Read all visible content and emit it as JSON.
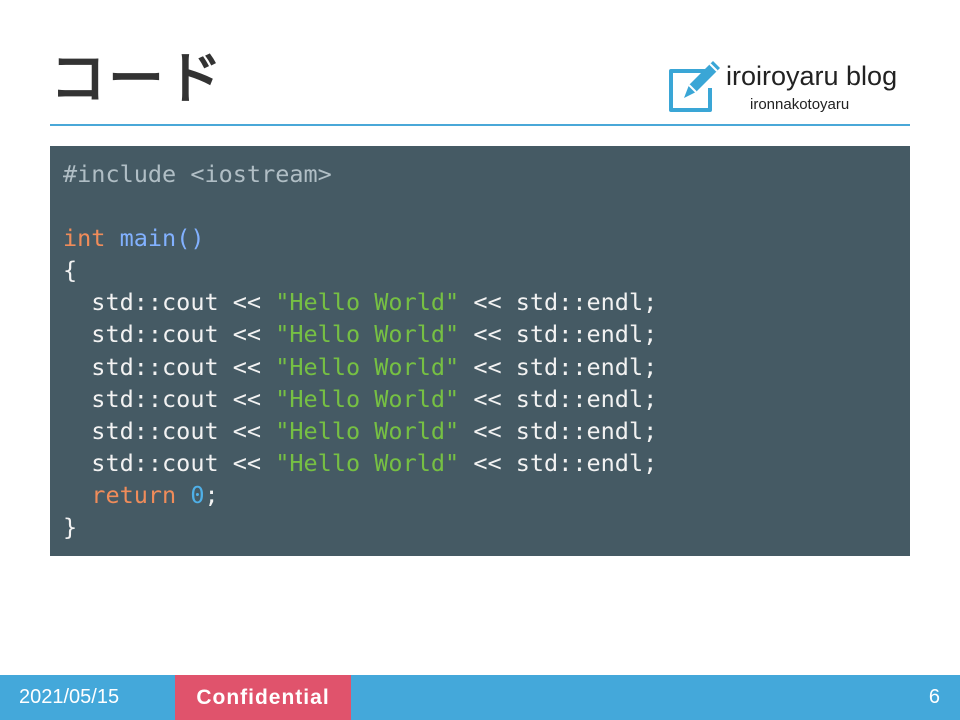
{
  "slide": {
    "title": "コード"
  },
  "logo": {
    "icon": "edit-document-icon",
    "name": "iroiroyaru blog",
    "subtitle": "ironnakotoyaru",
    "color": "#3aa6d6"
  },
  "code": {
    "background": "#455a64",
    "lines": [
      [
        {
          "t": "#include <iostream>",
          "c": "pre"
        }
      ],
      [],
      [
        {
          "t": "int",
          "c": "kw"
        },
        {
          "t": " ",
          "c": "txt"
        },
        {
          "t": "main()",
          "c": "fn"
        }
      ],
      [
        {
          "t": "{",
          "c": "txt"
        }
      ],
      [
        {
          "t": "  std::cout << ",
          "c": "txt"
        },
        {
          "t": "\"Hello World\"",
          "c": "str"
        },
        {
          "t": " << std::endl;",
          "c": "txt"
        }
      ],
      [
        {
          "t": "  std::cout << ",
          "c": "txt"
        },
        {
          "t": "\"Hello World\"",
          "c": "str"
        },
        {
          "t": " << std::endl;",
          "c": "txt"
        }
      ],
      [
        {
          "t": "  std::cout << ",
          "c": "txt"
        },
        {
          "t": "\"Hello World\"",
          "c": "str"
        },
        {
          "t": " << std::endl;",
          "c": "txt"
        }
      ],
      [
        {
          "t": "  std::cout << ",
          "c": "txt"
        },
        {
          "t": "\"Hello World\"",
          "c": "str"
        },
        {
          "t": " << std::endl;",
          "c": "txt"
        }
      ],
      [
        {
          "t": "  std::cout << ",
          "c": "txt"
        },
        {
          "t": "\"Hello World\"",
          "c": "str"
        },
        {
          "t": " << std::endl;",
          "c": "txt"
        }
      ],
      [
        {
          "t": "  std::cout << ",
          "c": "txt"
        },
        {
          "t": "\"Hello World\"",
          "c": "str"
        },
        {
          "t": " << std::endl;",
          "c": "txt"
        }
      ],
      [
        {
          "t": "  ",
          "c": "txt"
        },
        {
          "t": "return",
          "c": "kw"
        },
        {
          "t": " ",
          "c": "txt"
        },
        {
          "t": "0",
          "c": "num"
        },
        {
          "t": ";",
          "c": "txt"
        }
      ],
      [
        {
          "t": "}",
          "c": "txt"
        }
      ]
    ]
  },
  "footer": {
    "date": "2021/05/15",
    "confidential": "Confidential",
    "page_number": "6",
    "bar_color": "#44a8da",
    "badge_color": "#e0536c"
  }
}
